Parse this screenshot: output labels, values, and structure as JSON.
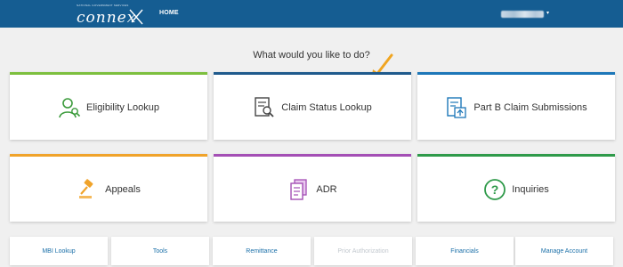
{
  "header": {
    "logo_tagline": "NATIONAL GOVERNMENT SERVICES",
    "logo_text": "connex",
    "nav_home": "HOME",
    "user_caret": "▾"
  },
  "heading": "What would you like to do?",
  "cards": [
    {
      "label": "Eligibility Lookup",
      "icon": "person-search-icon",
      "color": "#7dbf3e"
    },
    {
      "label": "Claim Status Lookup",
      "icon": "document-search-icon",
      "color": "#1f5a8c"
    },
    {
      "label": "Part B Claim Submissions",
      "icon": "document-upload-icon",
      "color": "#1d77b8"
    },
    {
      "label": "Appeals",
      "icon": "gavel-icon",
      "color": "#f0a32a"
    },
    {
      "label": "ADR",
      "icon": "documents-icon",
      "color": "#a44fb5"
    },
    {
      "label": "Inquiries",
      "icon": "question-circle-icon",
      "color": "#2f9a4a"
    }
  ],
  "quick_links": [
    {
      "label": "MBI Lookup",
      "enabled": true
    },
    {
      "label": "Tools",
      "enabled": true
    },
    {
      "label": "Remittance",
      "enabled": true
    },
    {
      "label": "Prior Authorization",
      "enabled": false
    },
    {
      "label": "Financials",
      "enabled": true
    },
    {
      "label": "Manage Account",
      "enabled": true
    }
  ],
  "colors": {
    "header_bg": "#155d92",
    "page_bg": "#f0f0f0",
    "link": "#1a6fa8",
    "arrow": "#f0a521"
  }
}
